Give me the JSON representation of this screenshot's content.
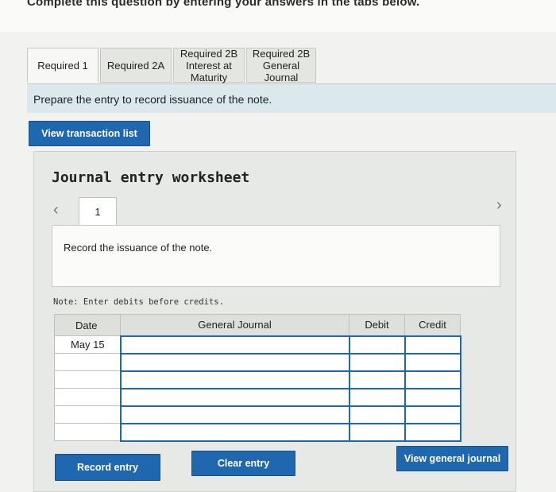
{
  "header": {
    "cut_text": "Complete this question by entering your answers in the tabs below."
  },
  "tabs": [
    {
      "label": "Required 1"
    },
    {
      "label": "Required 2A"
    },
    {
      "label": "Required 2B Interest at Maturity"
    },
    {
      "label": "Required 2B General Journal"
    }
  ],
  "instruction": "Prepare the entry to record issuance of the note.",
  "buttons": {
    "view_transaction": "View transaction list",
    "record": "Record entry",
    "clear": "Clear entry",
    "view_journal": "View general journal"
  },
  "worksheet": {
    "title": "Journal entry worksheet",
    "page_number": "1",
    "description": "Record the issuance of the note.",
    "note": "Note: Enter debits before credits."
  },
  "journal_table": {
    "headers": {
      "date": "Date",
      "account": "General Journal",
      "debit": "Debit",
      "credit": "Credit"
    },
    "rows": [
      {
        "date": "May 15",
        "account": "",
        "debit": "",
        "credit": ""
      },
      {
        "date": "",
        "account": "",
        "debit": "",
        "credit": ""
      },
      {
        "date": "",
        "account": "",
        "debit": "",
        "credit": ""
      },
      {
        "date": "",
        "account": "",
        "debit": "",
        "credit": ""
      },
      {
        "date": "",
        "account": "",
        "debit": "",
        "credit": ""
      },
      {
        "date": "",
        "account": "",
        "debit": "",
        "credit": ""
      }
    ]
  },
  "colors": {
    "accent": "#1f67ae",
    "instruction_bg": "#dbe8ec"
  }
}
